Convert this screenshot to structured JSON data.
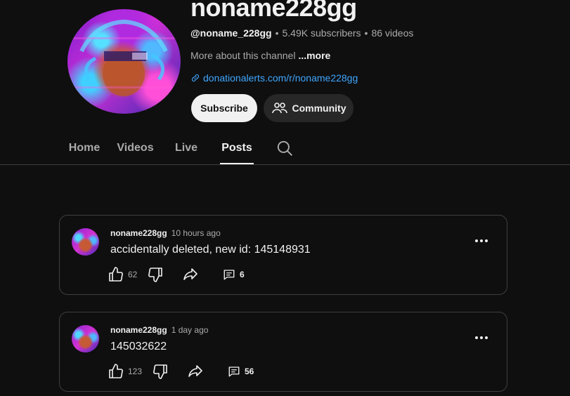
{
  "channel": {
    "name": "noname228gg",
    "handle": "@noname_228gg",
    "subscribers": "5.49K subscribers",
    "videos": "86 videos",
    "separator": "•",
    "about_label": "More about this channel",
    "more_label": "...more",
    "link": "donationalerts.com/r/noname228gg",
    "subscribe_label": "Subscribe",
    "community_label": "Community"
  },
  "tabs": [
    {
      "label": "Home"
    },
    {
      "label": "Videos"
    },
    {
      "label": "Live"
    },
    {
      "label": "Posts",
      "active": true
    }
  ],
  "posts": [
    {
      "author": "noname228gg",
      "time": "10 hours ago",
      "text": "accidentally deleted, new id: 145148931",
      "likes": "62",
      "comments": "6"
    },
    {
      "author": "noname228gg",
      "time": "1 day ago",
      "text": "145032622",
      "likes": "123",
      "comments": "56"
    }
  ],
  "icons": {
    "link": "link-icon",
    "community": "people-icon",
    "search": "search-icon",
    "like": "thumbs-up-icon",
    "dislike": "thumbs-down-icon",
    "share": "share-icon",
    "comment": "comment-icon",
    "menu": "more-vert-icon"
  },
  "colors": {
    "background": "#0f0f0f",
    "link": "#3ea6ff",
    "text": "#f1f1f1",
    "secondary": "#aaaaaa"
  }
}
